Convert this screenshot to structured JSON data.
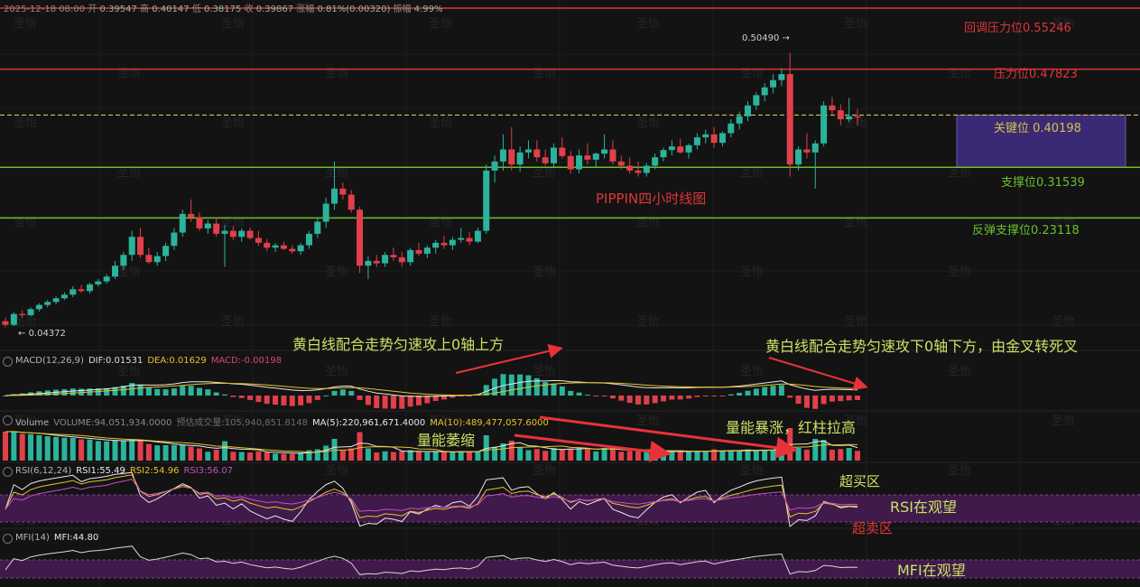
{
  "header": {
    "date": "2025-12-18 08:00",
    "open_label": "开",
    "open": "0.39547",
    "high_label": "高",
    "high": "0.40147",
    "low_label": "低",
    "low": "0.38175",
    "close_label": "收",
    "close": "0.39867",
    "change_label": "涨幅",
    "change": "0.81%(0.00320)",
    "amplitude_label": "振幅",
    "amplitude": "4.99%"
  },
  "watermark": "圣怡",
  "levels": [
    {
      "label": "回调压力位0.55246",
      "color": "#e0353a"
    },
    {
      "label": "压力位0.47823",
      "color": "#e0353a"
    },
    {
      "label": "关键位 0.40198",
      "color": "#d8c04a"
    },
    {
      "label": "支撑位0.31539",
      "color": "#6abf2e"
    },
    {
      "label": "反弹支撑位0.23118",
      "color": "#6abf2e"
    }
  ],
  "price_high_marker": "0.50490",
  "price_low_marker": "0.04372",
  "chart_title": "PIPPIN四小时线图",
  "macd": {
    "name": "MACD(12,26,9)",
    "dif": "DIF:0.01531",
    "dea": "DEA:0.01629",
    "macd": "MACD:-0.00198"
  },
  "volume": {
    "name": "Volume",
    "volume": "VOLUME:94,051,934.0000",
    "estimate": "预估成交量:105,940,851.8148",
    "ma5": "MA(5):220,961,671.4000",
    "ma10": "MA(10):489,477,057.6000"
  },
  "rsi": {
    "name": "RSI(6,12,24)",
    "rsi1": "RSI1:55.49",
    "rsi2": "RSI2:54.96",
    "rsi3": "RSI3:56.07"
  },
  "mfi": {
    "name": "MFI(14)",
    "mfi": "MFI:44.80"
  },
  "annotations": {
    "macd_left": "黄白线配合走势匀速攻上0轴上方",
    "macd_right": "黄白线配合走势匀速攻下0轴下方，由金叉转死叉",
    "vol_left": "量能萎缩",
    "vol_right": "量能暴涨，红柱拉高",
    "overbought": "超买区",
    "rsi_watch": "RSI在观望",
    "oversold": "超卖区",
    "mfi_watch": "MFI在观望"
  },
  "colors": {
    "up": "#2bb39b",
    "down": "#e0404a",
    "dif": "#e8e8e8",
    "dea": "#e6c229",
    "zone": "#3f1a4a",
    "key_zone": "#3a2a75"
  },
  "chart_data": {
    "type": "candlestick",
    "title": "PIPPIN四小时线图",
    "ohlc_approx": [
      [
        0.06,
        0.066,
        0.05,
        0.054
      ],
      [
        0.054,
        0.075,
        0.052,
        0.072
      ],
      [
        0.072,
        0.078,
        0.066,
        0.07
      ],
      [
        0.07,
        0.083,
        0.068,
        0.08
      ],
      [
        0.08,
        0.09,
        0.076,
        0.087
      ],
      [
        0.087,
        0.095,
        0.083,
        0.092
      ],
      [
        0.092,
        0.101,
        0.088,
        0.098
      ],
      [
        0.098,
        0.108,
        0.095,
        0.104
      ],
      [
        0.104,
        0.118,
        0.1,
        0.113
      ],
      [
        0.113,
        0.12,
        0.107,
        0.11
      ],
      [
        0.11,
        0.124,
        0.106,
        0.121
      ],
      [
        0.121,
        0.13,
        0.117,
        0.126
      ],
      [
        0.126,
        0.138,
        0.122,
        0.134
      ],
      [
        0.134,
        0.16,
        0.13,
        0.152
      ],
      [
        0.152,
        0.175,
        0.145,
        0.17
      ],
      [
        0.17,
        0.21,
        0.16,
        0.2
      ],
      [
        0.2,
        0.215,
        0.165,
        0.17
      ],
      [
        0.17,
        0.182,
        0.155,
        0.158
      ],
      [
        0.158,
        0.175,
        0.152,
        0.168
      ],
      [
        0.168,
        0.19,
        0.16,
        0.185
      ],
      [
        0.185,
        0.215,
        0.178,
        0.207
      ],
      [
        0.207,
        0.245,
        0.2,
        0.238
      ],
      [
        0.238,
        0.262,
        0.225,
        0.232
      ],
      [
        0.232,
        0.24,
        0.21,
        0.214
      ],
      [
        0.214,
        0.228,
        0.205,
        0.222
      ],
      [
        0.222,
        0.232,
        0.2,
        0.205
      ],
      [
        0.205,
        0.22,
        0.15,
        0.21
      ],
      [
        0.21,
        0.218,
        0.195,
        0.2
      ],
      [
        0.2,
        0.214,
        0.192,
        0.21
      ],
      [
        0.21,
        0.215,
        0.195,
        0.198
      ],
      [
        0.198,
        0.21,
        0.185,
        0.19
      ],
      [
        0.19,
        0.196,
        0.176,
        0.182
      ],
      [
        0.182,
        0.19,
        0.175,
        0.186
      ],
      [
        0.186,
        0.192,
        0.178,
        0.18
      ],
      [
        0.18,
        0.186,
        0.172,
        0.176
      ],
      [
        0.176,
        0.19,
        0.17,
        0.186
      ],
      [
        0.186,
        0.21,
        0.18,
        0.205
      ],
      [
        0.205,
        0.232,
        0.198,
        0.225
      ],
      [
        0.225,
        0.265,
        0.215,
        0.255
      ],
      [
        0.255,
        0.325,
        0.245,
        0.28
      ],
      [
        0.28,
        0.29,
        0.262,
        0.27
      ],
      [
        0.27,
        0.278,
        0.24,
        0.245
      ],
      [
        0.245,
        0.25,
        0.14,
        0.152
      ],
      [
        0.152,
        0.168,
        0.13,
        0.16
      ],
      [
        0.16,
        0.17,
        0.15,
        0.156
      ],
      [
        0.156,
        0.175,
        0.15,
        0.17
      ],
      [
        0.17,
        0.182,
        0.16,
        0.166
      ],
      [
        0.166,
        0.175,
        0.15,
        0.158
      ],
      [
        0.158,
        0.182,
        0.152,
        0.178
      ],
      [
        0.178,
        0.19,
        0.168,
        0.172
      ],
      [
        0.172,
        0.186,
        0.165,
        0.182
      ],
      [
        0.182,
        0.195,
        0.172,
        0.19
      ],
      [
        0.19,
        0.202,
        0.18,
        0.186
      ],
      [
        0.186,
        0.2,
        0.178,
        0.195
      ],
      [
        0.195,
        0.215,
        0.19,
        0.198
      ],
      [
        0.198,
        0.208,
        0.186,
        0.192
      ],
      [
        0.192,
        0.215,
        0.19,
        0.21
      ],
      [
        0.21,
        0.32,
        0.205,
        0.31
      ],
      [
        0.31,
        0.335,
        0.29,
        0.325
      ],
      [
        0.325,
        0.37,
        0.31,
        0.345
      ],
      [
        0.345,
        0.382,
        0.31,
        0.32
      ],
      [
        0.32,
        0.35,
        0.308,
        0.34
      ],
      [
        0.34,
        0.36,
        0.33,
        0.345
      ],
      [
        0.345,
        0.36,
        0.325,
        0.332
      ],
      [
        0.332,
        0.345,
        0.318,
        0.322
      ],
      [
        0.322,
        0.355,
        0.315,
        0.348
      ],
      [
        0.348,
        0.365,
        0.33,
        0.334
      ],
      [
        0.334,
        0.342,
        0.305,
        0.312
      ],
      [
        0.312,
        0.345,
        0.305,
        0.335
      ],
      [
        0.335,
        0.355,
        0.32,
        0.328
      ],
      [
        0.328,
        0.34,
        0.315,
        0.338
      ],
      [
        0.338,
        0.37,
        0.33,
        0.345
      ],
      [
        0.345,
        0.36,
        0.32,
        0.325
      ],
      [
        0.325,
        0.335,
        0.312,
        0.318
      ],
      [
        0.318,
        0.332,
        0.305,
        0.31
      ],
      [
        0.31,
        0.325,
        0.3,
        0.306
      ],
      [
        0.306,
        0.322,
        0.3,
        0.318
      ],
      [
        0.318,
        0.338,
        0.312,
        0.332
      ],
      [
        0.332,
        0.348,
        0.325,
        0.344
      ],
      [
        0.344,
        0.36,
        0.335,
        0.35
      ],
      [
        0.35,
        0.362,
        0.338,
        0.34
      ],
      [
        0.34,
        0.355,
        0.33,
        0.352
      ],
      [
        0.352,
        0.372,
        0.345,
        0.365
      ],
      [
        0.365,
        0.378,
        0.355,
        0.37
      ],
      [
        0.37,
        0.382,
        0.348,
        0.356
      ],
      [
        0.356,
        0.375,
        0.35,
        0.372
      ],
      [
        0.372,
        0.395,
        0.365,
        0.388
      ],
      [
        0.388,
        0.408,
        0.378,
        0.4
      ],
      [
        0.4,
        0.425,
        0.392,
        0.418
      ],
      [
        0.418,
        0.44,
        0.41,
        0.435
      ],
      [
        0.435,
        0.455,
        0.425,
        0.448
      ],
      [
        0.448,
        0.47,
        0.438,
        0.46
      ],
      [
        0.46,
        0.48,
        0.45,
        0.47
      ],
      [
        0.47,
        0.505,
        0.3,
        0.32
      ],
      [
        0.32,
        0.35,
        0.31,
        0.345
      ],
      [
        0.345,
        0.372,
        0.33,
        0.34
      ],
      [
        0.34,
        0.36,
        0.28,
        0.355
      ],
      [
        0.355,
        0.425,
        0.35,
        0.418
      ],
      [
        0.418,
        0.432,
        0.4,
        0.41
      ],
      [
        0.41,
        0.42,
        0.385,
        0.395
      ],
      [
        0.395,
        0.43,
        0.39,
        0.4
      ],
      [
        0.4,
        0.412,
        0.385,
        0.398
      ]
    ],
    "levels": [
      0.55246,
      0.47823,
      0.40198,
      0.31539,
      0.23118
    ],
    "marked_high": 0.5049,
    "marked_low": 0.04372,
    "indicators": {
      "macd": {
        "dif": 0.01531,
        "dea": 0.01629,
        "macd": -0.00198
      },
      "volume": {
        "volume": 94051934.0,
        "estimate": 105940851.8148,
        "ma5": 220961671.4,
        "ma10": 489477057.6
      },
      "rsi": {
        "rsi1": 55.49,
        "rsi2": 54.96,
        "rsi3": 56.07
      },
      "mfi": {
        "mfi": 44.8
      }
    }
  }
}
